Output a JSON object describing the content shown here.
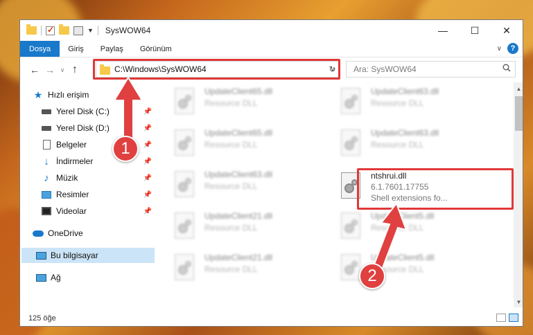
{
  "window": {
    "title": "SysWOW64"
  },
  "ribbon": {
    "tabs": [
      "Dosya",
      "Giriş",
      "Paylaş",
      "Görünüm"
    ]
  },
  "address": {
    "path": "C:\\Windows\\SysWOW64",
    "search_placeholder": "Ara: SysWOW64"
  },
  "sidebar": {
    "items": [
      {
        "label": "Hızlı erişim",
        "icon": "star-icon"
      },
      {
        "label": "Yerel Disk (C:)",
        "icon": "drive-icon"
      },
      {
        "label": "Yerel Disk (D:)",
        "icon": "drive-icon"
      },
      {
        "label": "Belgeler",
        "icon": "documents-icon"
      },
      {
        "label": "İndirmeler",
        "icon": "downloads-icon"
      },
      {
        "label": "Müzik",
        "icon": "music-icon"
      },
      {
        "label": "Resimler",
        "icon": "pictures-icon"
      },
      {
        "label": "Videolar",
        "icon": "videos-icon"
      },
      {
        "label": "OneDrive",
        "icon": "cloud-icon"
      },
      {
        "label": "Bu bilgisayar",
        "icon": "computer-icon"
      },
      {
        "label": "Ağ",
        "icon": "network-icon"
      }
    ]
  },
  "files": [
    {
      "name": "UpdateClient65.dll",
      "sub": "Resource DLL"
    },
    {
      "name": "UpdateClient63.dll",
      "sub": "Resource DLL"
    },
    {
      "name": "UpdateClient65.dll",
      "sub": "Resource DLL"
    },
    {
      "name": "UpdateClient63.dll",
      "sub": "Resource DLL"
    },
    {
      "name": "UpdateClient63.dll",
      "sub": "Resource DLL"
    },
    {
      "name": "UpdateClient21.dll",
      "sub": "Resource DLL"
    },
    {
      "name": "UpdateClient5.dll",
      "sub": "Resource DLL"
    },
    {
      "name": "UpdateClient21.dll",
      "sub": "Resource DLL"
    },
    {
      "name": "UpdateClient5.dll",
      "sub": "Resource DLL"
    }
  ],
  "highlighted_file": {
    "name": "ntshrui.dll",
    "version": "6.1.7601.17755",
    "description": "Shell extensions fo..."
  },
  "status": {
    "count": "125 öğe"
  },
  "annotations": {
    "step1": "1",
    "step2": "2",
    "accent": "#e03838"
  },
  "colors": {
    "accent": "#1979ca",
    "selection": "#cce4f7"
  }
}
